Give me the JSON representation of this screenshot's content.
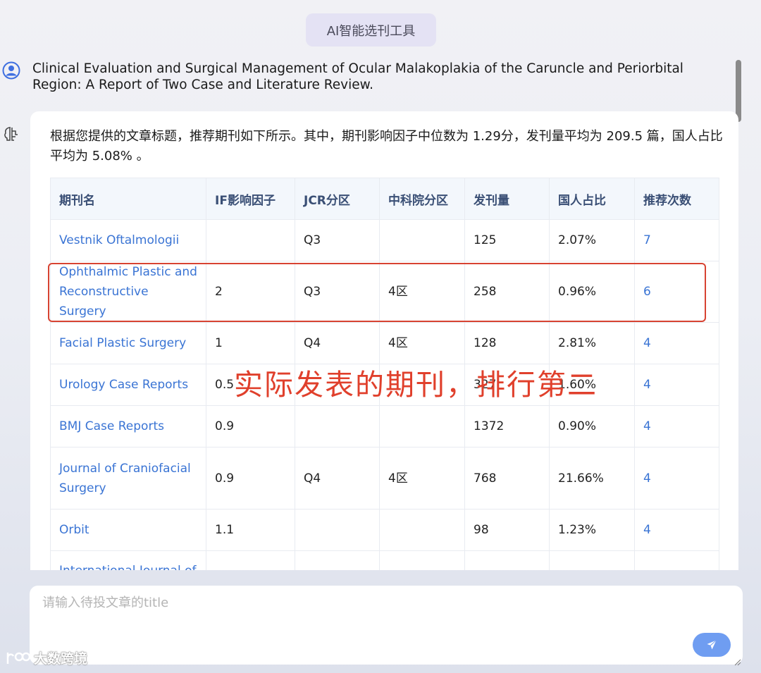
{
  "header": {
    "title": "AI智能选刊工具"
  },
  "user_message": "Clinical Evaluation and Surgical Management of Ocular Malakoplakia of the Caruncle and Periorbital Region: A Report of Two Case and Literature Review.",
  "answer": {
    "intro": "根据您提供的文章标题，推荐期刊如下所示。其中，期刊影响因子中位数为 1.29分，发刊量平均为 209.5 篇，国人占比平均为 5.08% 。",
    "table": {
      "headers": [
        "期刊名",
        "IF影响因子",
        "JCR分区",
        "中科院分区",
        "发刊量",
        "国人占比",
        "推荐次数"
      ],
      "rows": [
        {
          "name": "Vestnik Oftalmologii",
          "if": "",
          "jcr": "Q3",
          "cas": "",
          "volume": "125",
          "cn_ratio": "2.07%",
          "count": "7"
        },
        {
          "name": "Ophthalmic Plastic and Reconstructive Surgery",
          "if": "2",
          "jcr": "Q3",
          "cas": "4区",
          "volume": "258",
          "cn_ratio": "0.96%",
          "count": "6"
        },
        {
          "name": "Facial Plastic Surgery",
          "if": "1",
          "jcr": "Q4",
          "cas": "4区",
          "volume": "128",
          "cn_ratio": "2.81%",
          "count": "4"
        },
        {
          "name": "Urology Case Reports",
          "if": "0.5",
          "jcr": "",
          "cas": "",
          "volume": "327",
          "cn_ratio": "1.60%",
          "count": "4"
        },
        {
          "name": "BMJ Case Reports",
          "if": "0.9",
          "jcr": "",
          "cas": "",
          "volume": "1372",
          "cn_ratio": "0.90%",
          "count": "4"
        },
        {
          "name": "Journal of Craniofacial Surgery",
          "if": "0.9",
          "jcr": "Q4",
          "cas": "4区",
          "volume": "768",
          "cn_ratio": "21.66%",
          "count": "4"
        },
        {
          "name": "Orbit",
          "if": "1.1",
          "jcr": "",
          "cas": "",
          "volume": "98",
          "cn_ratio": "1.23%",
          "count": "4"
        },
        {
          "name": "International Journal of",
          "if": "",
          "jcr": "",
          "cas": "",
          "volume": "",
          "cn_ratio": "",
          "count": ""
        }
      ]
    }
  },
  "annotation": {
    "text": "实际发表的期刊，排行第二",
    "color": "#e0402c"
  },
  "input": {
    "placeholder": "请输入待投文章的title"
  },
  "watermark": {
    "text": "大数跨境"
  },
  "colors": {
    "link": "#3a74d4",
    "send_button": "#6f9df1",
    "highlight": "#d74332"
  }
}
